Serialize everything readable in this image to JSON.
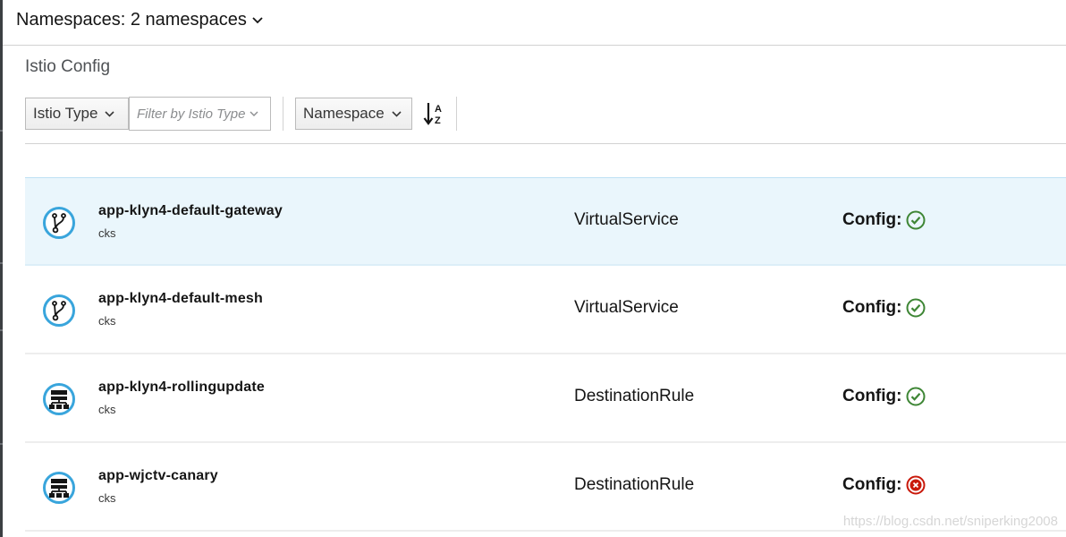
{
  "namespace_bar": {
    "label": "Namespaces: 2 namespaces",
    "chevron_icon": "chevron-down-icon"
  },
  "page": {
    "title": "Istio Config"
  },
  "toolbar": {
    "filter_type_label": "Istio Type",
    "filter_placeholder": "Filter by Istio Type",
    "sort_field_label": "Namespace",
    "sort_icon": "sort-alpha-asc-icon"
  },
  "rows": [
    {
      "name": "app-klyn4-default-gateway",
      "namespace": "cks",
      "type": "VirtualService",
      "config_label": "Config:",
      "status": "valid",
      "icon": "virtual-service-icon"
    },
    {
      "name": "app-klyn4-default-mesh",
      "namespace": "cks",
      "type": "VirtualService",
      "config_label": "Config:",
      "status": "valid",
      "icon": "virtual-service-icon"
    },
    {
      "name": "app-klyn4-rollingupdate",
      "namespace": "cks",
      "type": "DestinationRule",
      "config_label": "Config:",
      "status": "valid",
      "icon": "destination-rule-icon"
    },
    {
      "name": "app-wjctv-canary",
      "namespace": "cks",
      "type": "DestinationRule",
      "config_label": "Config:",
      "status": "error",
      "icon": "destination-rule-icon"
    }
  ],
  "colors": {
    "ok": "#3e8635",
    "error": "#c9190b",
    "icon_ring": "#39a5dc",
    "selected_row": "#eaf6fc"
  },
  "watermark": "https://blog.csdn.net/sniperking2008"
}
